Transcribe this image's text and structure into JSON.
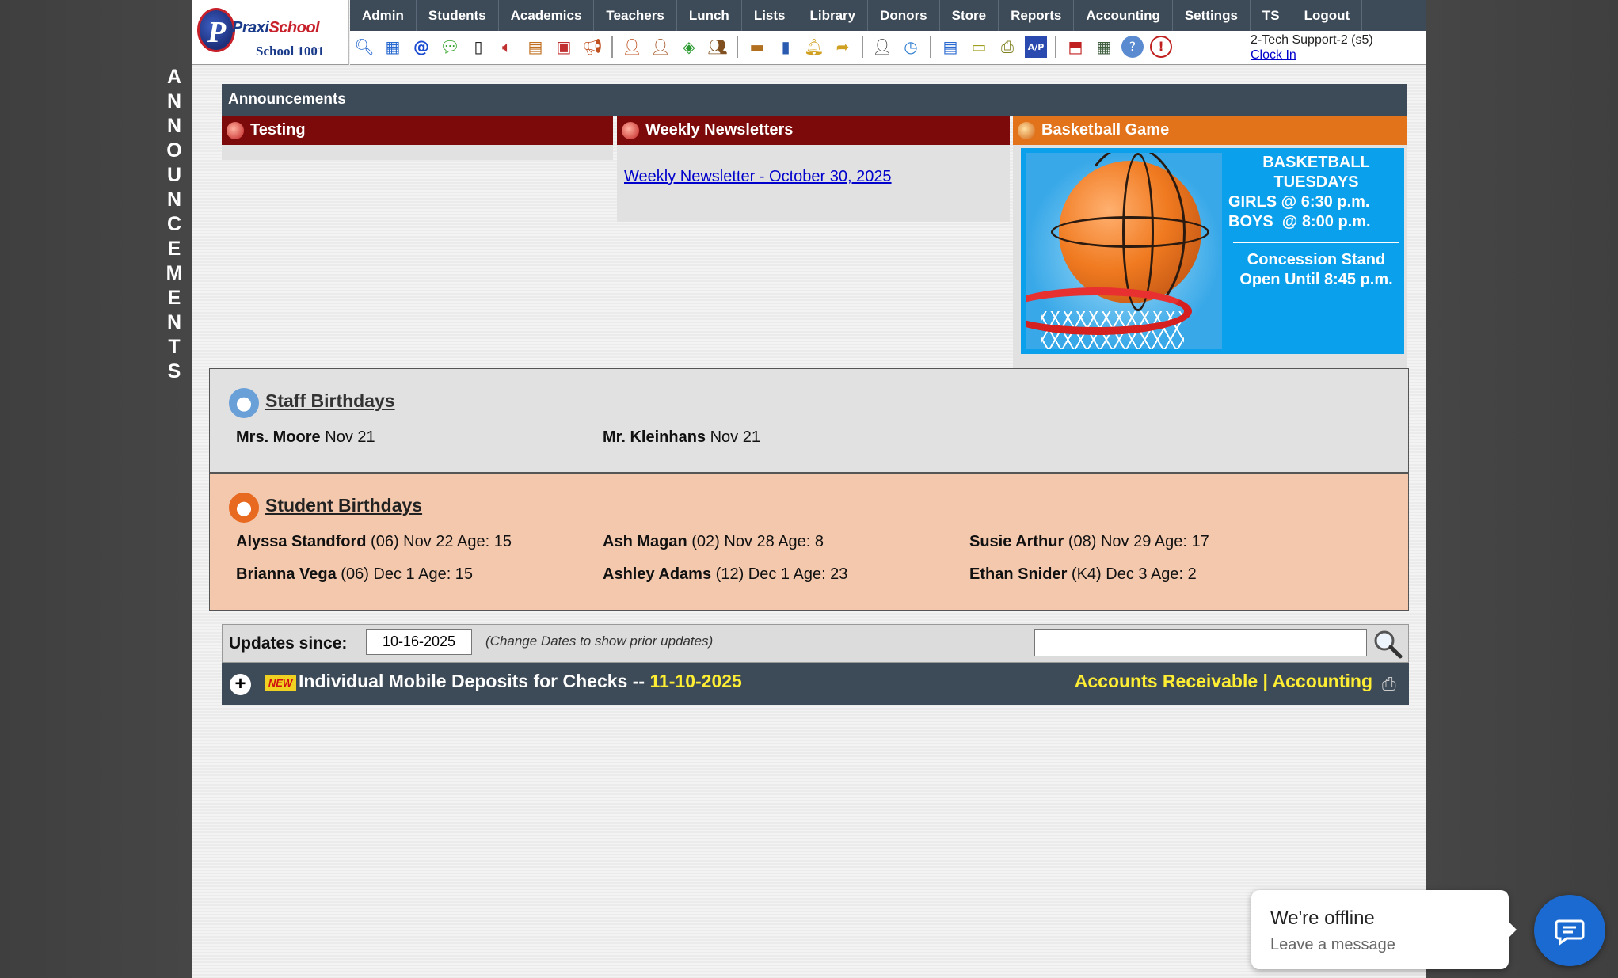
{
  "side_banner": [
    "A",
    "N",
    "N",
    "O",
    "U",
    "N",
    "C",
    "E",
    "M",
    "E",
    "N",
    "T",
    "S"
  ],
  "logo": {
    "brand_prefix": "Praxi",
    "brand_suffix": "School",
    "school": "School 1001"
  },
  "nav": [
    "Admin",
    "Students",
    "Academics",
    "Teachers",
    "Lunch",
    "Lists",
    "Library",
    "Donors",
    "Store",
    "Reports",
    "Accounting",
    "Settings",
    "TS",
    "Logout"
  ],
  "toolbar_icons": [
    "search-icon",
    "grid-icon",
    "email-icon",
    "chat-icon",
    "mobile-icon",
    "speaker-icon",
    "window-icon",
    "calendar-icon",
    "megaphone-icon",
    "user-add-icon",
    "user-icon",
    "money-icon",
    "users-icon",
    "lunch-icon",
    "book-icon",
    "bell-icon",
    "export-icon",
    "staff-icon",
    "clock-icon",
    "list-icon",
    "card-icon",
    "printer-icon",
    "ap-icon",
    "pdf-icon",
    "cash-icon",
    "help-icon",
    "alert-icon"
  ],
  "user": {
    "name": "2-Tech Support-2 (s5)",
    "clock": "Clock In"
  },
  "announcements": {
    "header": "Announcements",
    "col1": {
      "title": "Testing"
    },
    "col2": {
      "title": "Weekly Newsletters",
      "link": "Weekly Newsletter - October 30, 2025"
    },
    "col3": {
      "title": "Basketball Game",
      "line1": "BASKETBALL",
      "line2": "TUESDAYS",
      "line3": "GIRLS @ 6:30 p.m.",
      "line4": "BOYS  @ 8:00 p.m.",
      "line5": "Concession Stand",
      "line6": "Open Until 8:45 p.m."
    }
  },
  "staff_birthdays": {
    "title": "Staff Birthdays",
    "entries": [
      {
        "name": "Mrs. Moore",
        "info": "Nov 21"
      },
      {
        "name": "Mr. Kleinhans",
        "info": "Nov 21"
      }
    ]
  },
  "student_birthdays": {
    "title": "Student Birthdays",
    "entries": [
      {
        "name": "Alyssa Standford",
        "info": "(06) Nov 22 Age: 15"
      },
      {
        "name": "Ash Magan",
        "info": "(02) Nov 28 Age: 8"
      },
      {
        "name": "Susie Arthur",
        "info": "(08) Nov 29 Age: 17"
      },
      {
        "name": "Brianna Vega",
        "info": "(06) Dec 1 Age: 15"
      },
      {
        "name": "Ashley Adams",
        "info": "(12) Dec 1 Age: 23"
      },
      {
        "name": "Ethan Snider",
        "info": "(K4) Dec 3 Age: 2"
      }
    ]
  },
  "updates": {
    "label": "Updates since:",
    "date": "10-16-2025",
    "hint": "(Change Dates to show prior updates)",
    "search_placeholder": ""
  },
  "update_item": {
    "new_badge": "NEW",
    "title": "Individual Mobile Deposits for Checks --",
    "date": "11-10-2025",
    "category1": "Accounts Receivable",
    "separator": "|",
    "category2": "Accounting"
  },
  "chat": {
    "status": "We're offline",
    "action": "Leave a message"
  }
}
